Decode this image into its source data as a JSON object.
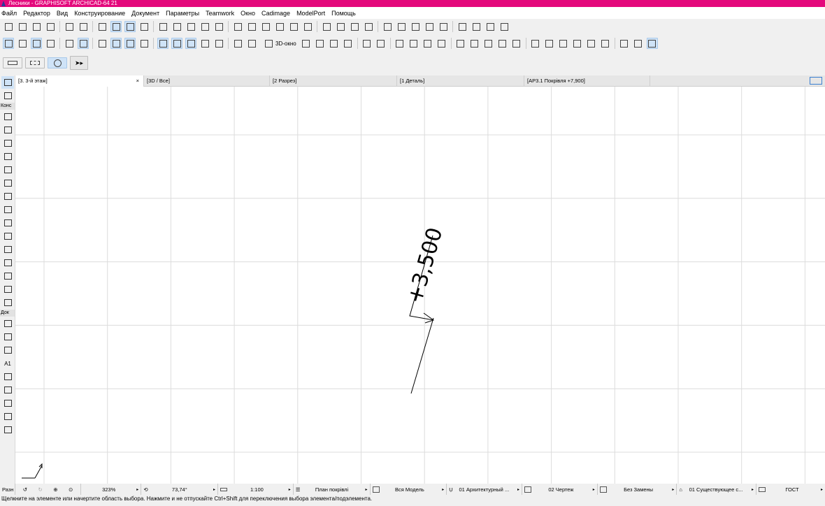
{
  "window": {
    "title": "Лесники - GRAPHISOFT ARCHICAD-64 21"
  },
  "menu": [
    "Файл",
    "Редактор",
    "Вид",
    "Конструирование",
    "Документ",
    "Параметры",
    "Teamwork",
    "Окно",
    "Cadimage",
    "ModelPort",
    "Помощь"
  ],
  "toolbar": {
    "btn_3d": "3D-окно"
  },
  "tabs": [
    {
      "label": "[3. 3-й этаж]",
      "close": "×"
    },
    {
      "label": "[3D / Все]"
    },
    {
      "label": "[2 Разрез]"
    },
    {
      "label": "[1 Деталь]"
    },
    {
      "label": "[АР3.1 Покрівля +7,900]"
    }
  ],
  "toolbox": {
    "groups": [
      "Конс",
      "Док",
      "Разн"
    ],
    "a1_label": "A1"
  },
  "drawing": {
    "elevation_label": "+3,500"
  },
  "status": {
    "zoom": "323%",
    "angle": "73,74°",
    "scale": "1:100",
    "layer_combo": "План покрівлі",
    "model_view": "Вся Модель",
    "pen_set": "01 Архитектурный ...",
    "drawing": "02 Чертеж",
    "override": "Без Замены",
    "renovation": "01 Существующее с...",
    "dimension": "ГОСТ"
  },
  "hint": "Щелкните на элементе или начертите область выбора. Нажмите и не отпускайте Ctrl+Shift для переключения выбора элемента/подэлемента.",
  "colors": {
    "title": "#e4087c",
    "active_button": "#cfe3f7"
  }
}
